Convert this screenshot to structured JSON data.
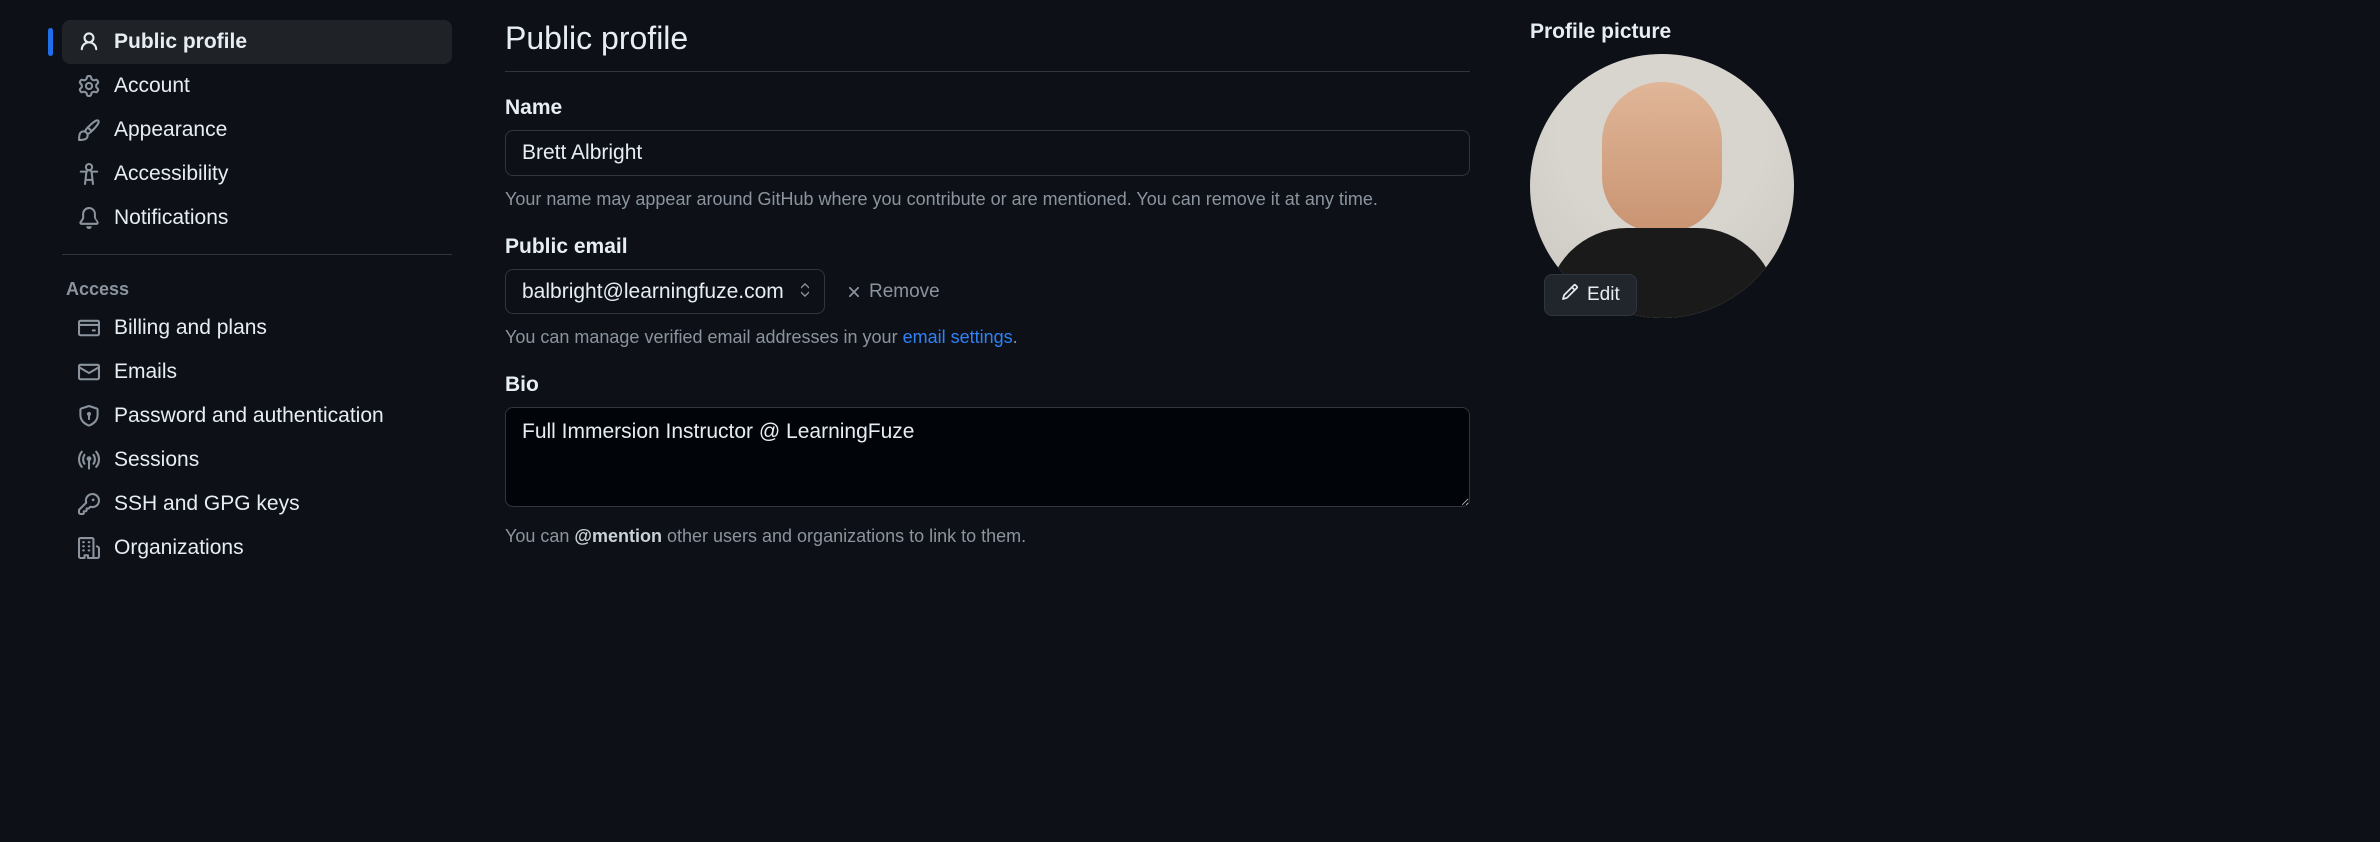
{
  "sidebar": {
    "items": [
      {
        "label": "Public profile",
        "icon": "person-icon",
        "active": true
      },
      {
        "label": "Account",
        "icon": "gear-icon",
        "active": false
      },
      {
        "label": "Appearance",
        "icon": "paintbrush-icon",
        "active": false
      },
      {
        "label": "Accessibility",
        "icon": "accessibility-icon",
        "active": false
      },
      {
        "label": "Notifications",
        "icon": "bell-icon",
        "active": false
      }
    ],
    "access_header": "Access",
    "access_items": [
      {
        "label": "Billing and plans",
        "icon": "credit-card-icon"
      },
      {
        "label": "Emails",
        "icon": "mail-icon"
      },
      {
        "label": "Password and authentication",
        "icon": "shield-lock-icon"
      },
      {
        "label": "Sessions",
        "icon": "broadcast-icon"
      },
      {
        "label": "SSH and GPG keys",
        "icon": "key-icon"
      },
      {
        "label": "Organizations",
        "icon": "organization-icon"
      }
    ]
  },
  "main": {
    "title": "Public profile",
    "name": {
      "label": "Name",
      "value": "Brett Albright",
      "help": "Your name may appear around GitHub where you contribute or are mentioned. You can remove it at any time."
    },
    "email": {
      "label": "Public email",
      "value": "balbright@learningfuze.com",
      "remove_label": "Remove",
      "help_prefix": "You can manage verified email addresses in your ",
      "help_link": "email settings",
      "help_suffix": "."
    },
    "bio": {
      "label": "Bio",
      "value": "Full Immersion Instructor @ LearningFuze",
      "help_prefix": "You can ",
      "help_strong": "@mention",
      "help_suffix": " other users and organizations to link to them."
    },
    "picture": {
      "label": "Profile picture",
      "edit_label": "Edit"
    }
  }
}
